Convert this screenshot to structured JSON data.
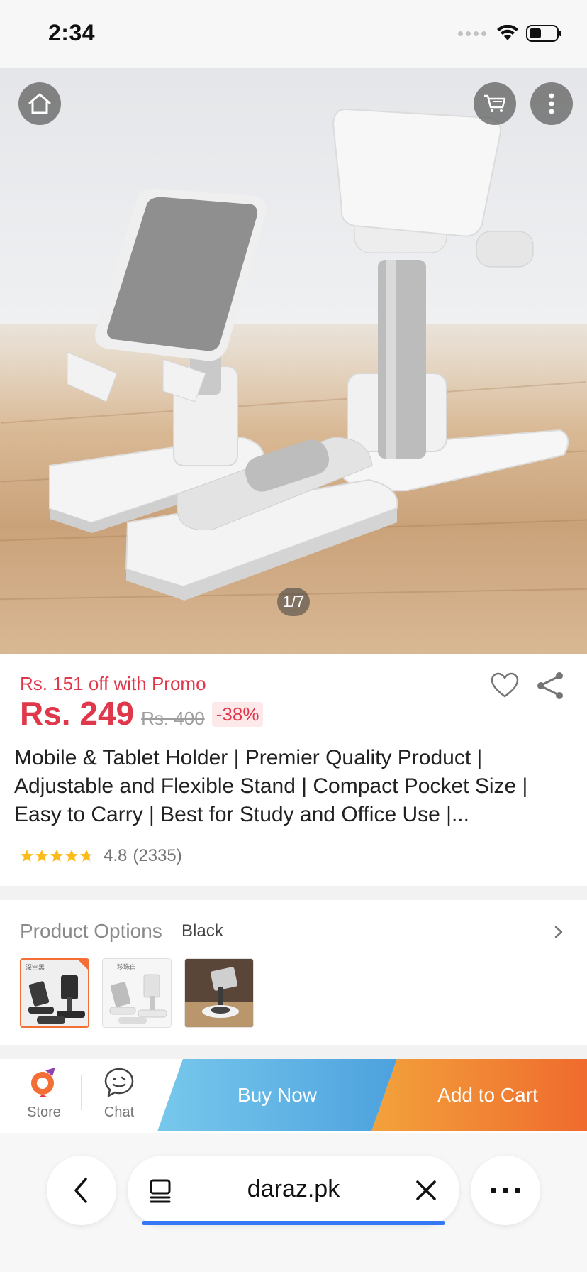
{
  "status_bar": {
    "time": "2:34"
  },
  "gallery": {
    "page_indicator": "1/7"
  },
  "product": {
    "promo_text": "Rs. 151 off with Promo",
    "price": "Rs. 249",
    "original_price": "Rs. 400",
    "discount": "-38%",
    "title": "Mobile & Tablet Holder | Premier Quality Product | Adjustable and Flexible Stand | Compact Pocket Size | Easy to Carry | Best for Study and Office Use |...",
    "rating": "4.8",
    "rating_count": "(2335)",
    "stars": 4.8
  },
  "options": {
    "label": "Product Options",
    "selected_value": "Black",
    "thumbnails": [
      {
        "name": "black",
        "caption": "深空黑"
      },
      {
        "name": "white",
        "caption": "珍珠白"
      },
      {
        "name": "rotating",
        "caption": ""
      }
    ]
  },
  "action_bar": {
    "store_label": "Store",
    "chat_label": "Chat",
    "buy_now_label": "Buy Now",
    "add_to_cart_label": "Add to Cart"
  },
  "browser": {
    "url": "daraz.pk"
  },
  "colors": {
    "price_red": "#e0384b",
    "buy_now_blue": "#4da2de",
    "add_cart_orange": "#ef6b2d",
    "selected_border": "#f36f36",
    "browser_progress": "#3478f6"
  }
}
